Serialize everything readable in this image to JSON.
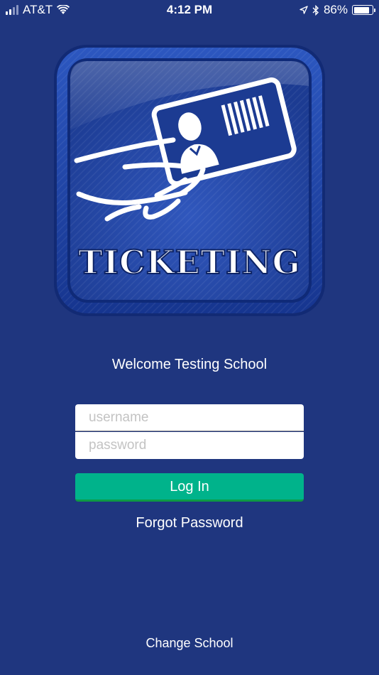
{
  "status_bar": {
    "carrier": "AT&T",
    "time": "4:12 PM",
    "battery_percent": "86%",
    "battery_level": 0.86
  },
  "logo": {
    "text": "TICKETING",
    "icon": "ticket-card-in-hand-icon"
  },
  "welcome_text": "Welcome Testing School",
  "login_form": {
    "username_placeholder": "username",
    "password_placeholder": "password",
    "login_label": "Log In"
  },
  "forgot_password_label": "Forgot Password",
  "change_school_label": "Change School",
  "colors": {
    "background": "#1f367f",
    "button": "#00b38b",
    "button_border": "#0d9a44"
  }
}
